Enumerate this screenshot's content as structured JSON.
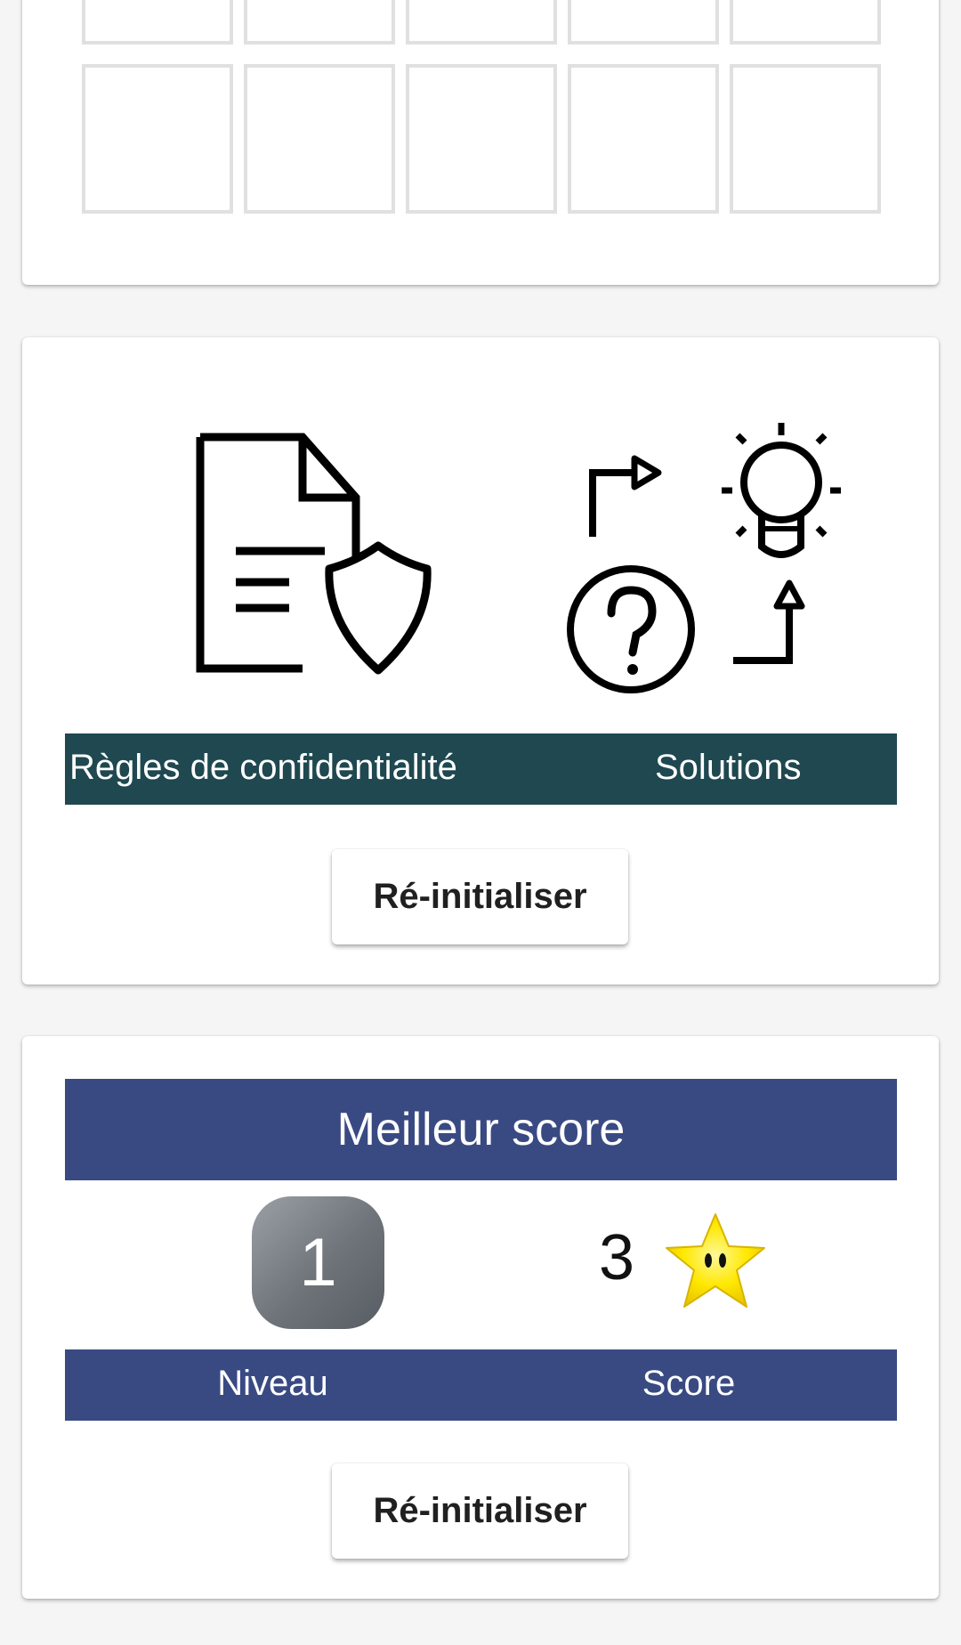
{
  "grid_card": {
    "rows": 2,
    "columns": 5
  },
  "info_card": {
    "privacy_label": "Règles de confidentialité",
    "solutions_label": "Solutions",
    "reset_label": "Ré-initialiser",
    "privacy_icon": "document-shield-icon",
    "solutions_icon": "question-lightbulb-icon",
    "bar_color": "#1f4850"
  },
  "score_card": {
    "title": "Meilleur score",
    "level_value": "1",
    "score_value": "3",
    "level_label": "Niveau",
    "score_label": "Score",
    "reset_label": "Ré-initialiser",
    "star_icon": "star-icon",
    "header_color": "#394a83"
  }
}
